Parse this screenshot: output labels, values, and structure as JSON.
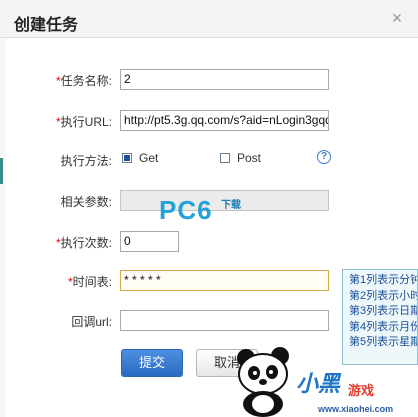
{
  "dialog": {
    "title": "创建任务",
    "close_glyph": "×"
  },
  "form": {
    "required_mark": "*",
    "name": {
      "label": "任务名称:",
      "value": "2"
    },
    "url": {
      "label": "执行URL:",
      "value": "http://pt5.3g.qq.com/s?aid=nLogin3gqq"
    },
    "method": {
      "label": "执行方法:",
      "options": [
        {
          "label": "Get",
          "checked": true
        },
        {
          "label": "Post",
          "checked": false
        }
      ],
      "help_glyph": "?"
    },
    "params": {
      "label": "相关参数:",
      "value": ""
    },
    "count": {
      "label": "执行次数:",
      "value": "0"
    },
    "schedule": {
      "label": "时间表:",
      "value": "* * * * *"
    },
    "callback": {
      "label": "回调url:",
      "value": ""
    }
  },
  "buttons": {
    "submit": "提交",
    "cancel": "取消"
  },
  "tooltip": {
    "lines": [
      "第1列表示分钟",
      "第2列表示小时",
      "第3列表示日期",
      "第4列表示月份",
      "第5列表示星期"
    ]
  },
  "watermarks": {
    "pc6": "PC6",
    "pc6_sub": "下载",
    "site_name": "小黑",
    "site_sub": "游戏",
    "site_url": "www.xiaohei.com"
  },
  "colors": {
    "accent_blue": "#2b6ac4",
    "required_red": "#e00000",
    "tooltip_text": "#1a4f9a"
  }
}
